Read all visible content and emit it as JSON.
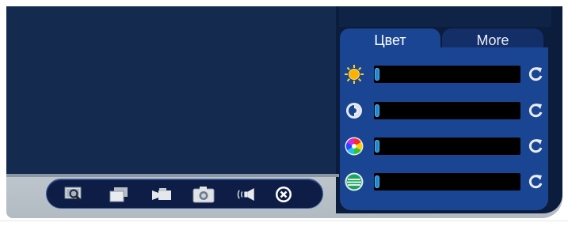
{
  "panel": {
    "tabs": [
      {
        "label": "Цвет",
        "active": true
      },
      {
        "label": "More",
        "active": false
      }
    ],
    "sliders": [
      {
        "name": "brightness",
        "icon": "sun-icon",
        "value": 0
      },
      {
        "name": "contrast",
        "icon": "contrast-icon",
        "value": 0
      },
      {
        "name": "saturation",
        "icon": "color-wheel-icon",
        "value": 0
      },
      {
        "name": "sharpness",
        "icon": "striped-circle-icon",
        "value": 0
      }
    ]
  },
  "toolbar": {
    "buttons": [
      {
        "icon": "zoom-icon"
      },
      {
        "icon": "windows-icon"
      },
      {
        "icon": "camcorder-icon"
      },
      {
        "icon": "camera-icon"
      },
      {
        "icon": "audio-icon"
      },
      {
        "icon": "close-icon"
      }
    ]
  },
  "colors": {
    "video_background": "#142a4f",
    "panel": "#1a4592",
    "slider_track": "#000000",
    "slider_thumb": "#1e8ad6"
  }
}
